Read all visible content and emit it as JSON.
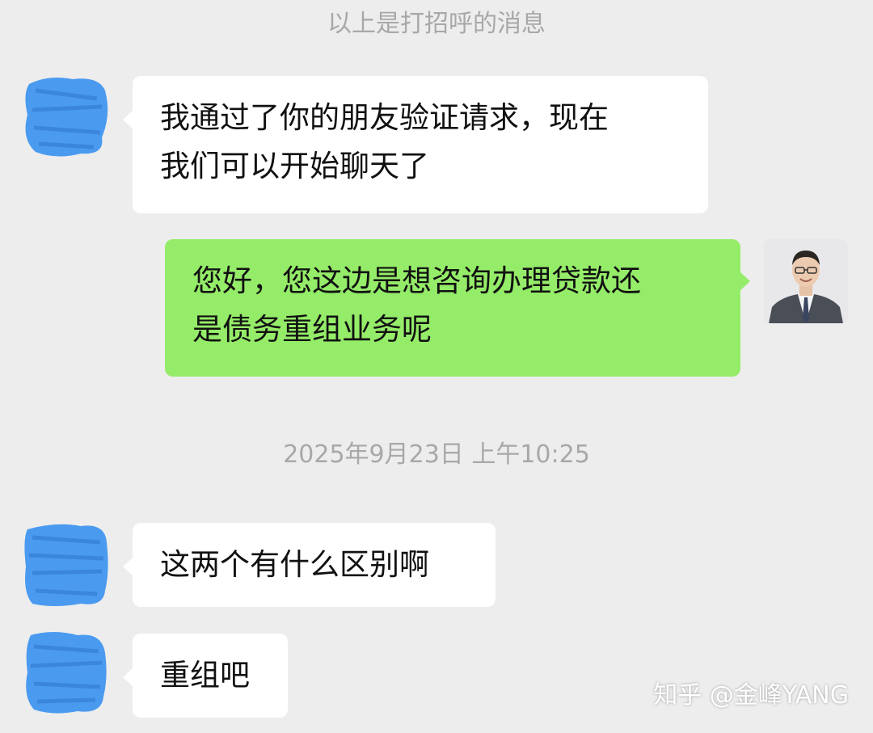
{
  "system_notice": "以上是打招呼的消息",
  "timestamp": "2025年9月23日 上午10:25",
  "messages": [
    {
      "side": "incoming",
      "lines": [
        "我通过了你的朋友验证请求，现在",
        "我们可以开始聊天了"
      ]
    },
    {
      "side": "outgoing",
      "lines": [
        "您好，您这边是想咨询办理贷款还",
        "是债务重组业务呢"
      ]
    },
    {
      "side": "incoming",
      "lines": [
        "这两个有什么区别啊"
      ]
    },
    {
      "side": "incoming",
      "lines": [
        "重组吧"
      ]
    }
  ],
  "watermark": "知乎 @金峰YANG",
  "colors": {
    "background": "#ededed",
    "incoming_bubble": "#ffffff",
    "outgoing_bubble": "#95ec69",
    "avatar_redaction": "#4a9af0"
  },
  "icons": {
    "incoming_avatar": "redacted-avatar-scribble",
    "outgoing_avatar": "man-in-suit-photo"
  }
}
